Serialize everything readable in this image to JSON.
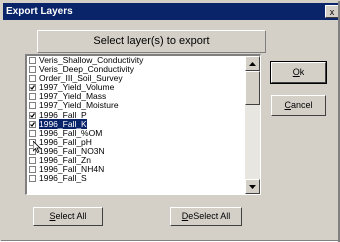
{
  "window": {
    "title": "Export Layers",
    "close_glyph": "x"
  },
  "header": {
    "label": "Select layer(s) to export"
  },
  "list": {
    "items": [
      {
        "label": "Veris_Shallow_Conductivity",
        "checked": false,
        "selected": false
      },
      {
        "label": "Veris_Deep_Conductivity",
        "checked": false,
        "selected": false
      },
      {
        "label": "Order_III_Soil_Survey",
        "checked": false,
        "selected": false
      },
      {
        "label": "1997_Yield_Volume",
        "checked": true,
        "selected": false
      },
      {
        "label": "1997_Yield_Mass",
        "checked": false,
        "selected": false
      },
      {
        "label": "1997_Yield_Moisture",
        "checked": false,
        "selected": false
      },
      {
        "label": "1996_Fall_P",
        "checked": true,
        "selected": false
      },
      {
        "label": "1996_Fall_K",
        "checked": true,
        "selected": true
      },
      {
        "label": "1996_Fall_%OM",
        "checked": false,
        "selected": false
      },
      {
        "label": "1996_Fall_pH",
        "checked": false,
        "selected": false
      },
      {
        "label": "1996_Fall_NO3N",
        "checked": false,
        "selected": false
      },
      {
        "label": "1996_Fall_Zn",
        "checked": false,
        "selected": false
      },
      {
        "label": "1996_Fall_NH4N",
        "checked": false,
        "selected": false
      },
      {
        "label": "1996_Fall_S",
        "checked": false,
        "selected": false
      }
    ]
  },
  "buttons": {
    "ok": {
      "mnemonic": "O",
      "rest": "k"
    },
    "cancel": {
      "mnemonic": "C",
      "rest": "ancel"
    },
    "select_all": {
      "mnemonic": "S",
      "rest": "elect All"
    },
    "deselect_all": {
      "mnemonic": "D",
      "rest": "eSelect All"
    }
  },
  "icons": {
    "scroll_up": "scroll-up-arrow-icon",
    "scroll_down": "scroll-down-arrow-icon",
    "check": "checkmark-icon"
  },
  "colors": {
    "title_bar": "#0a246a",
    "selection": "#0a246a",
    "face": "#d4d0c8"
  }
}
